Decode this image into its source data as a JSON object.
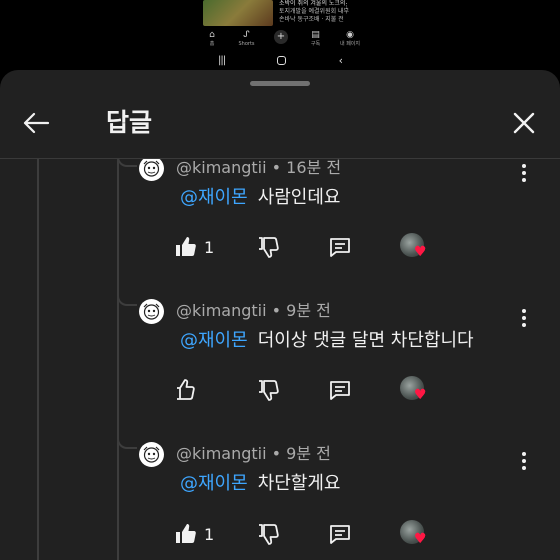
{
  "background": {
    "video_title": "소박이 쥐의 겨울의 노크의",
    "video_subtitle": "토지개발을 예결위원회 내부",
    "video_meta": "손바낙 동구조배 · 지불 전",
    "nav": [
      {
        "icon": "home-icon",
        "label": "홈"
      },
      {
        "icon": "shorts-icon",
        "label": "Shorts"
      },
      {
        "icon": "create-icon",
        "label": ""
      },
      {
        "icon": "subscriptions-icon",
        "label": "구독"
      },
      {
        "icon": "library-icon",
        "label": "내 페이지"
      }
    ]
  },
  "header": {
    "title": "답글"
  },
  "comments": [
    {
      "handle": "@kimangtii",
      "time": "16분 전",
      "mention": "@재이몬",
      "text": "사람인데요",
      "like_count": "1",
      "liked": true
    },
    {
      "handle": "@kimangtii",
      "time": "9분 전",
      "mention": "@재이몬",
      "text": "더이상 댓글 달면 차단합니다",
      "like_count": "",
      "liked": false
    },
    {
      "handle": "@kimangtii",
      "time": "9분 전",
      "mention": "@재이몬",
      "text": "차단할게요",
      "like_count": "1",
      "liked": true
    }
  ],
  "colors": {
    "sheet_bg": "#212121",
    "mention": "#3ea6ff",
    "heart": "#ff1744",
    "meta_text": "#aaaaaa"
  }
}
